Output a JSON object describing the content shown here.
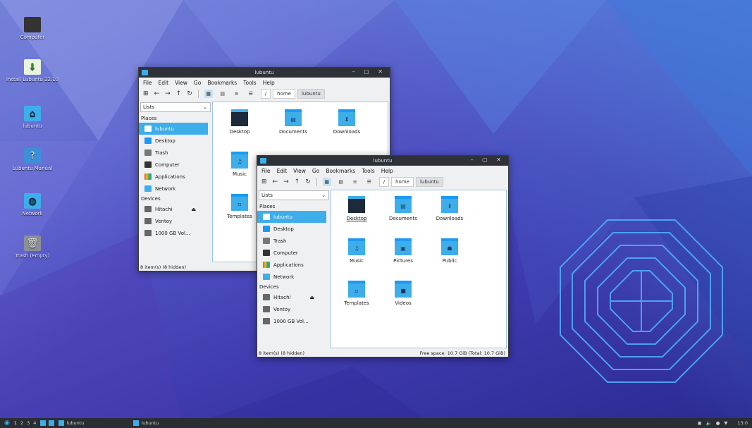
{
  "desktop": {
    "icons": [
      {
        "label": "Computer",
        "icon": "computer-icon"
      },
      {
        "label": "Install Lubuntu 22.10",
        "icon": "install-icon"
      },
      {
        "label": "lubuntu",
        "icon": "home-folder-icon"
      },
      {
        "label": "Lubuntu Manual",
        "icon": "help-icon"
      },
      {
        "label": "Network",
        "icon": "network-icon"
      },
      {
        "label": "Trash (Empty)",
        "icon": "trash-icon"
      }
    ]
  },
  "windows": {
    "back": {
      "title": "lubuntu",
      "menu": [
        "File",
        "Edit",
        "View",
        "Go",
        "Bookmarks",
        "Tools",
        "Help"
      ],
      "path": [
        "/",
        "home",
        "lubuntu"
      ],
      "combo": "Lists",
      "places_header": "Places",
      "places": [
        "lubuntu",
        "Desktop",
        "Trash",
        "Computer",
        "Applications",
        "Network"
      ],
      "devices_header": "Devices",
      "devices": [
        "Hitachi",
        "Ventoy",
        "1000 GB Vol..."
      ],
      "files": [
        "Desktop",
        "Documents",
        "Downloads",
        "Music",
        "Templates"
      ],
      "status_left": "8 item(s) (8 hidden)"
    },
    "front": {
      "title": "lubuntu",
      "menu": [
        "File",
        "Edit",
        "View",
        "Go",
        "Bookmarks",
        "Tools",
        "Help"
      ],
      "path": [
        "/",
        "home",
        "lubuntu"
      ],
      "combo": "Lists",
      "places_header": "Places",
      "places": [
        "lubuntu",
        "Desktop",
        "Trash",
        "Computer",
        "Applications",
        "Network"
      ],
      "devices_header": "Devices",
      "devices": [
        "Hitachi",
        "Ventoy",
        "1000 GB Vol..."
      ],
      "files": [
        "Desktop",
        "Documents",
        "Downloads",
        "Music",
        "Pictures",
        "Public",
        "Templates",
        "Videos"
      ],
      "status_left": "8 item(s) (8 hidden)",
      "status_right": "Free space: 10.7 GiB (Total: 10.7 GiB)"
    }
  },
  "taskbar": {
    "desktops": [
      "1",
      "2",
      "3",
      "4"
    ],
    "task1": "lubuntu",
    "task2": "lubuntu",
    "clock": "13:0"
  }
}
